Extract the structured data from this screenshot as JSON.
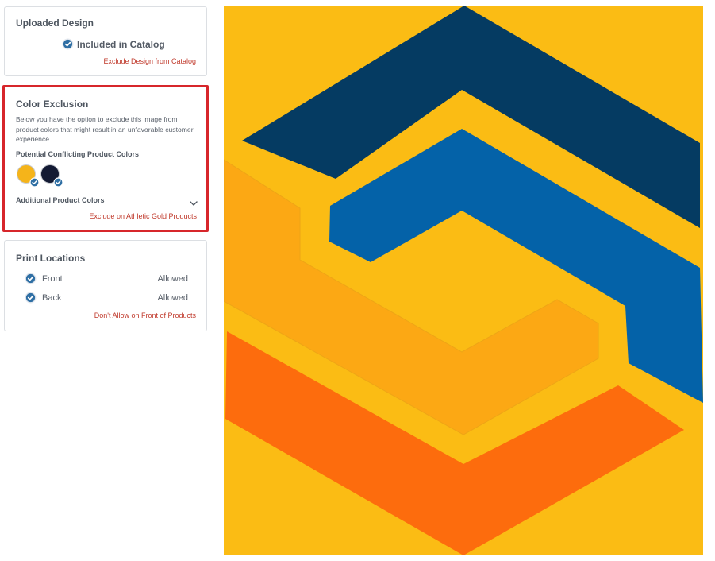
{
  "uploaded_design": {
    "title": "Uploaded Design",
    "status": "Included in Catalog",
    "action": "Exclude Design from Catalog"
  },
  "color_exclusion": {
    "title": "Color Exclusion",
    "description": "Below you have the option to exclude this image from product colors that might result in an unfavorable customer experience.",
    "conflicting_label": "Potential Conflicting Product Colors",
    "swatches": [
      {
        "name": "Athletic Gold",
        "color": "#f5b41a"
      },
      {
        "name": "Navy",
        "color": "#131a33"
      }
    ],
    "additional_label": "Additional Product Colors",
    "action": "Exclude on Athletic Gold Products"
  },
  "print_locations": {
    "title": "Print Locations",
    "locations": [
      {
        "name": "Front",
        "status": "Allowed"
      },
      {
        "name": "Back",
        "status": "Allowed"
      }
    ],
    "action": "Don't Allow on Front of Products"
  },
  "artwork_colors": {
    "background": "#fbbc14",
    "navy": "#053b62",
    "blue": "#0462a8",
    "gold": "#fca814",
    "orange": "#fd6c0d"
  },
  "icons": {
    "check": "check-circle-icon",
    "chevron": "chevron-down-icon"
  }
}
